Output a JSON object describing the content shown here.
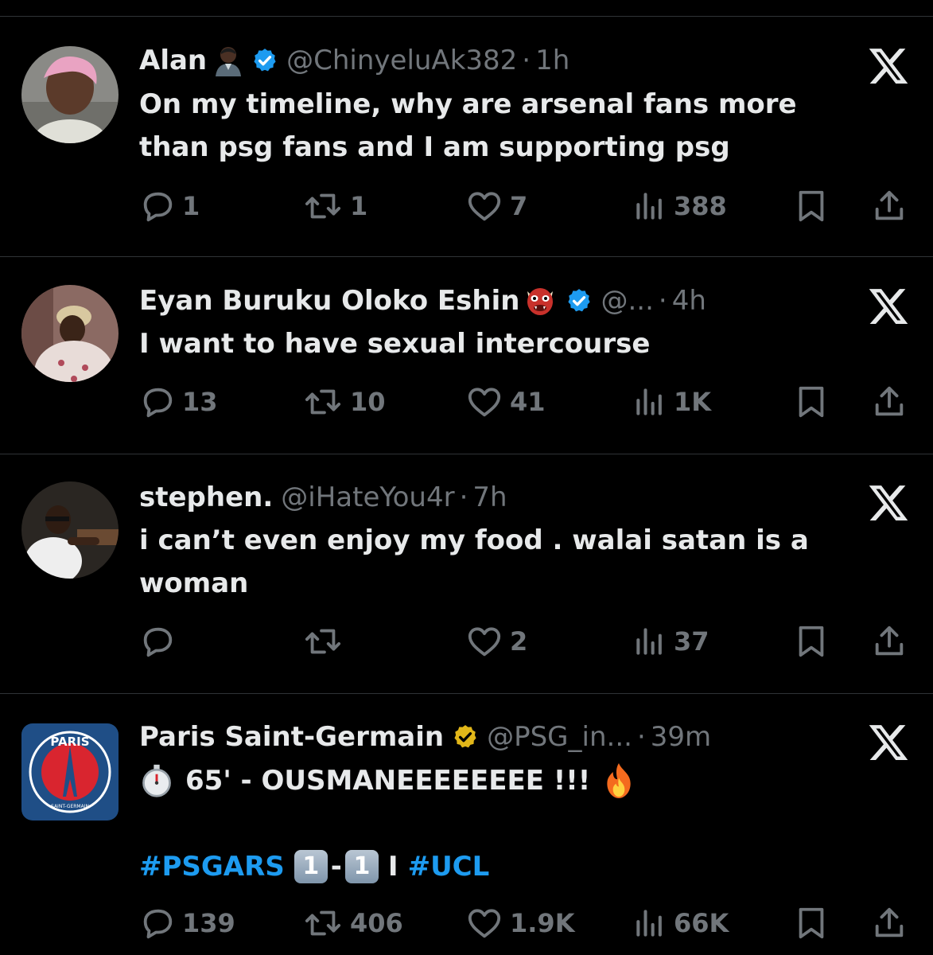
{
  "tweets": [
    {
      "name": "Alan",
      "handle": "@ChinyeluAk382",
      "dot": "·",
      "time": "1h",
      "text": "On my timeline, why are arsenal fans more than psg fans and I am supporting psg",
      "replies": "1",
      "retweets": "1",
      "likes": "7",
      "views": "388"
    },
    {
      "name": "Eyan Buruku Oloko Eshin",
      "handle": "@...",
      "dot": "·",
      "time": "4h",
      "text": "I want to have sexual intercourse",
      "replies": "13",
      "retweets": "10",
      "likes": "41",
      "views": "1K"
    },
    {
      "name": "stephen.",
      "handle": "@iHateYou4r",
      "dot": "·",
      "time": "7h",
      "text": "i can’t even enjoy my food . walai satan is a woman",
      "replies": "",
      "retweets": "",
      "likes": "2",
      "views": "37"
    },
    {
      "name": "Paris Saint-Germain",
      "handle": "@PSG_in...",
      "dot": "·",
      "time": "39m",
      "text": "65' - OUSMANEEEEEEEE !!!",
      "hashtag1": "#PSGARS",
      "score_home": "1",
      "score_sep": "-",
      "score_away": "1",
      "divider": "I",
      "hashtag2": "#UCL",
      "logo_text_top": "PARIS",
      "logo_text_bottom": "SAINT-GERMAIN",
      "replies": "139",
      "retweets": "406",
      "likes": "1.9K",
      "views": "66K"
    }
  ],
  "colors": {
    "background": "#000000",
    "text": "#e7e9ea",
    "secondary": "#71767b",
    "link": "#1d9bf0",
    "verified_blue": "#1d9bf0",
    "verified_gold": "#e2b719",
    "separator": "#2f3336"
  },
  "icons": [
    "x-logo-icon",
    "verified-badge-icon",
    "reply-icon",
    "retweet-icon",
    "like-icon",
    "views-icon",
    "bookmark-icon",
    "share-icon"
  ]
}
